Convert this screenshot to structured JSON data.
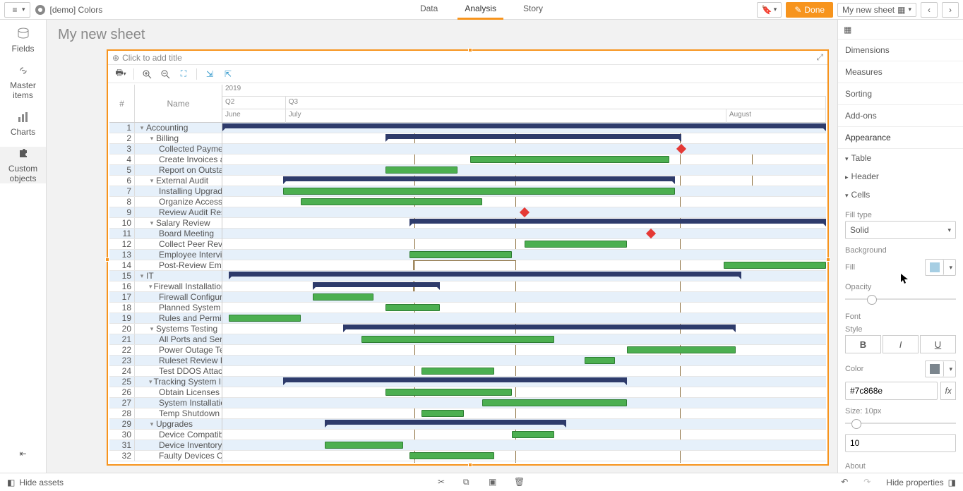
{
  "app": {
    "title": "[demo] Colors"
  },
  "nav": {
    "data": "Data",
    "analysis": "Analysis",
    "story": "Story"
  },
  "topbar": {
    "done": "Done",
    "sheet_name": "My new sheet"
  },
  "leftbar": {
    "fields": "Fields",
    "master_items": "Master items",
    "charts": "Charts",
    "custom_objects": "Custom objects"
  },
  "sheet": {
    "title": "My new sheet"
  },
  "viz": {
    "title_placeholder": "Click to add title",
    "timeline": {
      "year": "2019",
      "q2": "Q2",
      "q3": "Q3",
      "june": "June",
      "july": "July",
      "august": "August"
    },
    "grid": {
      "num": "#",
      "name": "Name"
    }
  },
  "rows": [
    {
      "n": 1,
      "lvl": 0,
      "toggle": "▾",
      "label": "Accounting",
      "type": "summary",
      "start": 0,
      "end": 100
    },
    {
      "n": 2,
      "lvl": 1,
      "toggle": "▾",
      "label": "Billing",
      "type": "summary",
      "start": 27,
      "end": 76
    },
    {
      "n": 3,
      "lvl": 2,
      "label": "Collected Payments Review",
      "type": "milestone",
      "pos": 76
    },
    {
      "n": 4,
      "lvl": 2,
      "label": "Create Invoices and Send to Customers",
      "type": "task",
      "start": 41,
      "end": 74
    },
    {
      "n": 5,
      "lvl": 2,
      "label": "Report on Outstanding Collections",
      "type": "task",
      "start": 27,
      "end": 39
    },
    {
      "n": 6,
      "lvl": 1,
      "toggle": "▾",
      "label": "External Audit",
      "type": "summary",
      "start": 10,
      "end": 75
    },
    {
      "n": 7,
      "lvl": 2,
      "label": "Installing Upgrades",
      "type": "task",
      "start": 10,
      "end": 75
    },
    {
      "n": 8,
      "lvl": 2,
      "label": "Organize Access for External Auditors",
      "type": "task",
      "start": 13,
      "end": 43
    },
    {
      "n": 9,
      "lvl": 2,
      "label": "Review Audit Results",
      "type": "milestone",
      "pos": 50
    },
    {
      "n": 10,
      "lvl": 1,
      "toggle": "▾",
      "label": "Salary Review",
      "type": "summary",
      "start": 31,
      "end": 100
    },
    {
      "n": 11,
      "lvl": 2,
      "label": "Board Meeting",
      "type": "milestone",
      "pos": 71
    },
    {
      "n": 12,
      "lvl": 2,
      "label": "Collect Peer Review Data",
      "type": "task",
      "start": 50,
      "end": 67
    },
    {
      "n": 13,
      "lvl": 2,
      "label": "Employee Interviews",
      "type": "task",
      "start": 31,
      "end": 48
    },
    {
      "n": 14,
      "lvl": 2,
      "label": "Post-Review Employee Induction",
      "type": "task",
      "start": 83,
      "end": 100
    },
    {
      "n": 15,
      "lvl": 0,
      "toggle": "▾",
      "label": "IT",
      "type": "summary",
      "start": 1,
      "end": 86
    },
    {
      "n": 16,
      "lvl": 1,
      "toggle": "▾",
      "label": "Firewall Installation",
      "type": "summary",
      "start": 15,
      "end": 36
    },
    {
      "n": 17,
      "lvl": 2,
      "label": "Firewall Configuration",
      "type": "task",
      "start": 15,
      "end": 25
    },
    {
      "n": 18,
      "lvl": 2,
      "label": "Planned System Restart",
      "type": "task",
      "start": 27,
      "end": 36
    },
    {
      "n": 19,
      "lvl": 2,
      "label": "Rules and Permissions Audit",
      "type": "task",
      "start": 1,
      "end": 13
    },
    {
      "n": 20,
      "lvl": 1,
      "toggle": "▾",
      "label": "Systems Testing",
      "type": "summary",
      "start": 20,
      "end": 85
    },
    {
      "n": 21,
      "lvl": 2,
      "label": "All Ports and Services Test",
      "type": "task",
      "start": 23,
      "end": 55
    },
    {
      "n": 22,
      "lvl": 2,
      "label": "Power Outage Tests",
      "type": "task",
      "start": 67,
      "end": 85
    },
    {
      "n": 23,
      "lvl": 2,
      "label": "Ruleset Review If Needed",
      "type": "task",
      "start": 60,
      "end": 65
    },
    {
      "n": 24,
      "lvl": 2,
      "label": "Test DDOS Attack",
      "type": "task",
      "start": 33,
      "end": 45
    },
    {
      "n": 25,
      "lvl": 1,
      "toggle": "▾",
      "label": "Tracking System Installation",
      "type": "summary",
      "start": 10,
      "end": 67
    },
    {
      "n": 26,
      "lvl": 2,
      "label": "Obtain Licenses from the Vendor",
      "type": "task",
      "start": 27,
      "end": 48
    },
    {
      "n": 27,
      "lvl": 2,
      "label": "System Installation",
      "type": "task",
      "start": 43,
      "end": 67
    },
    {
      "n": 28,
      "lvl": 2,
      "label": "Temp Shutdown for IT Audit",
      "type": "task",
      "start": 33,
      "end": 40
    },
    {
      "n": 29,
      "lvl": 1,
      "toggle": "▾",
      "label": "Upgrades",
      "type": "summary",
      "start": 17,
      "end": 57
    },
    {
      "n": 30,
      "lvl": 2,
      "label": "Device Compatibility Review",
      "type": "task",
      "start": 48,
      "end": 55
    },
    {
      "n": 31,
      "lvl": 2,
      "label": "Device Inventory",
      "type": "task",
      "start": 17,
      "end": 30
    },
    {
      "n": 32,
      "lvl": 2,
      "label": "Faulty Devices Check",
      "type": "task",
      "start": 31,
      "end": 45
    }
  ],
  "props": {
    "dimensions": "Dimensions",
    "measures": "Measures",
    "sorting": "Sorting",
    "addons": "Add-ons",
    "appearance": "Appearance",
    "table": "Table",
    "header": "Header",
    "cells": "Cells",
    "fill_type": "Fill type",
    "fill_type_val": "Solid",
    "background": "Background",
    "fill": "Fill",
    "fill_color": "#a6cee3",
    "opacity": "Opacity",
    "opacity_val": 20,
    "font": "Font",
    "style": "Style",
    "bold": "B",
    "italic": "I",
    "underline": "U",
    "color": "Color",
    "color_val": "#7c868e",
    "color_hex": "#7c868e",
    "size_label": "Size: 10px",
    "size_val": "10",
    "size_slider": 6,
    "about": "About"
  },
  "bottom": {
    "hide_assets": "Hide assets",
    "hide_properties": "Hide properties"
  }
}
